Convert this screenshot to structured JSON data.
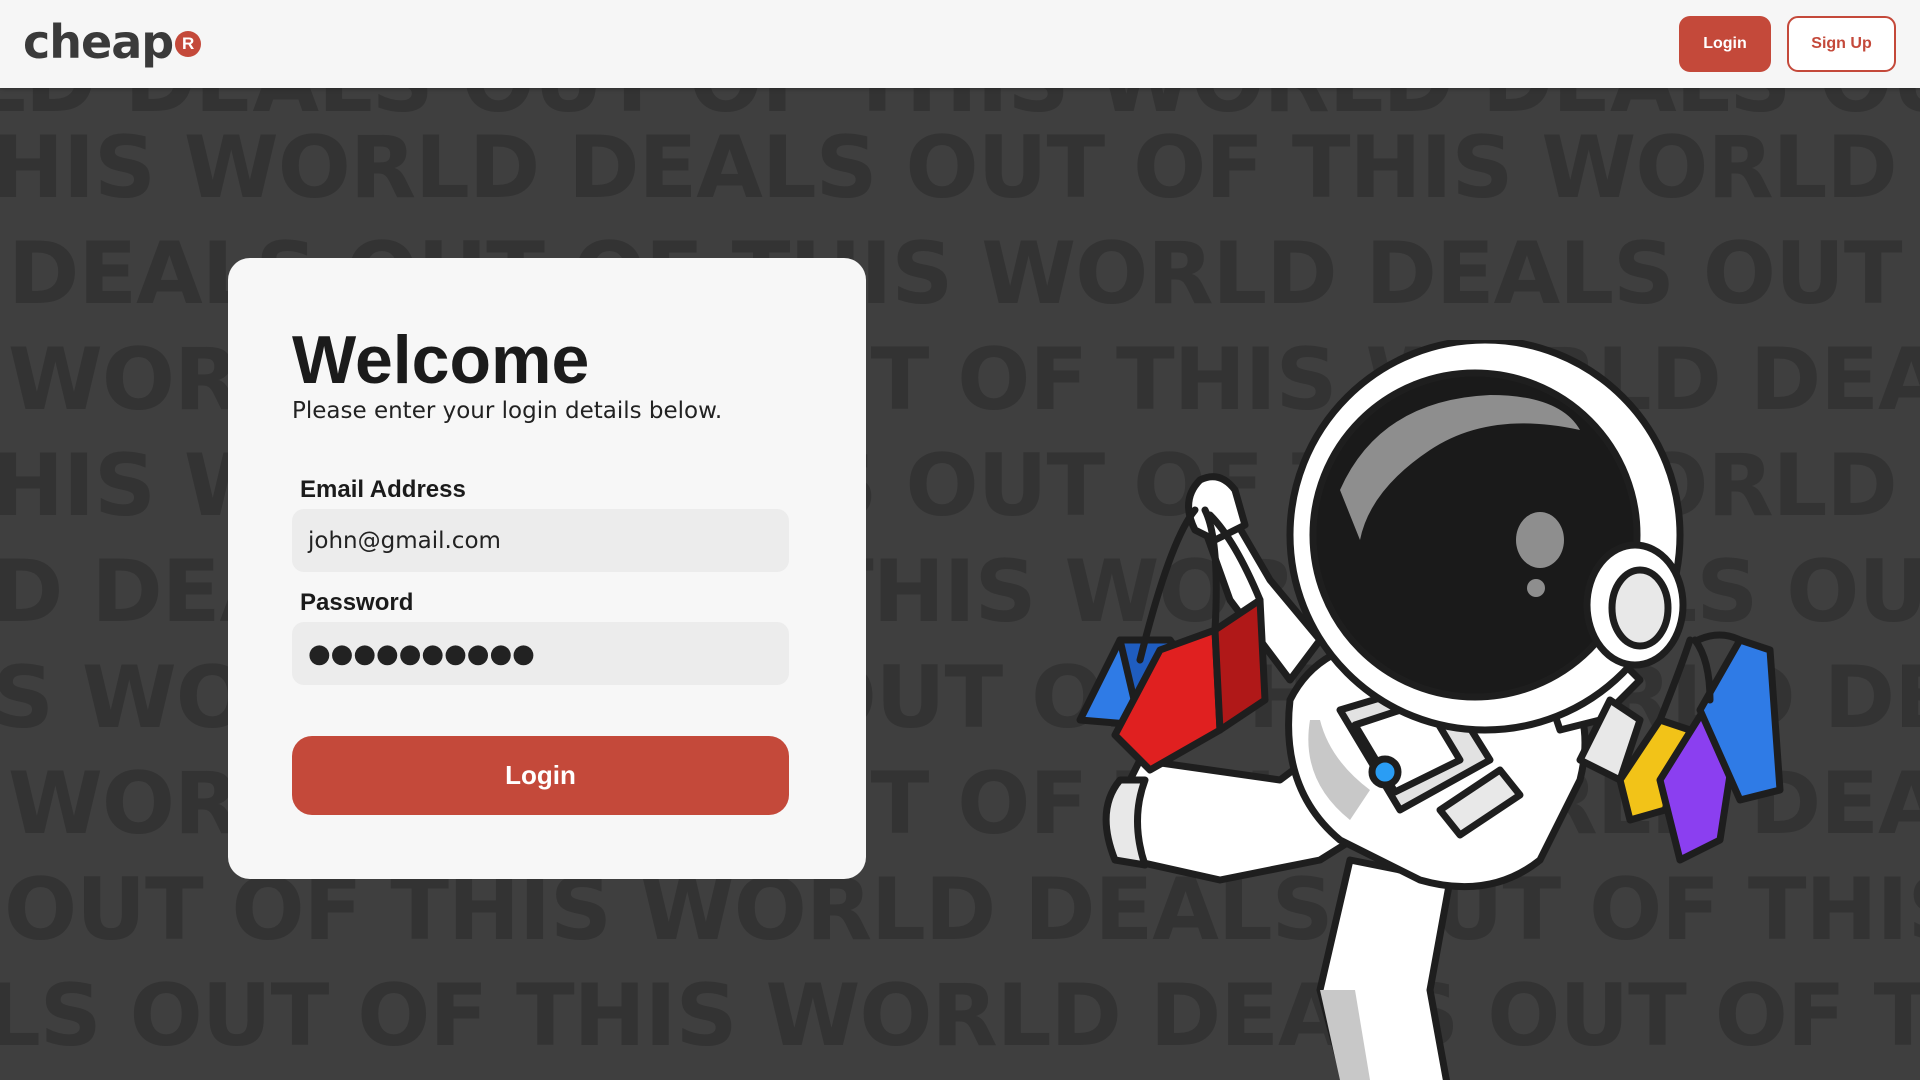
{
  "header": {
    "logo_text": "cheap",
    "logo_badge": "R",
    "login_label": "Login",
    "signup_label": "Sign Up"
  },
  "background": {
    "rows": [
      "WORLD DEALS OUT OF THIS WORLD DEALS OUT OF THIS WORLD DEALS OUT OF THIS",
      "HIS WORLD DEALS OUT OF THIS WORLD DEALS OUT OF THIS WORLD DEALS OUT OF",
      "DEALS OUT OF THIS WORLD DEALS OUT OF THIS WORLD DEALS OUT OF THIS WORLD",
      "WORLD DEALS OUT OF THIS WORLD DEALS OUT OF THIS WORLD DEALS OUT OF THIS",
      "HIS WORLD DEALS OUT OF THIS WORLD DEALS OUT OF THIS WORLD DEALS OUT OF",
      "D DEALS OUT OF THIS WORLD DEALS OUT OF THIS WORLD DEALS OUT OF THIS",
      "S WORLD DEALS OUT OF THIS WORLD DEALS OUT OF THIS WORLD DEALS OUT OF",
      "WORLD DEALS OUT OF THIS WORLD DEALS OUT OF THIS WORLD DEALS OUT OF THIS",
      "OUT OF THIS WORLD DEALS OUT OF THIS WORLD DEALS OUT OF THIS WORLD",
      "LS OUT OF THIS WORLD DEALS OUT OF THIS WORLD DEALS OUT OF THIS WORLD"
    ]
  },
  "login_form": {
    "title": "Welcome",
    "subtitle": "Please enter your login details below.",
    "email_label": "Email Address",
    "email_value": "john@gmail.com",
    "password_label": "Password",
    "password_mask": "●●●●●●●●●●",
    "submit_label": "Login"
  },
  "colors": {
    "accent": "#c4493a",
    "background": "#3f3f3f",
    "card": "#f7f7f7"
  },
  "icons": {
    "illustration": "astronaut-shopping-illustration"
  }
}
